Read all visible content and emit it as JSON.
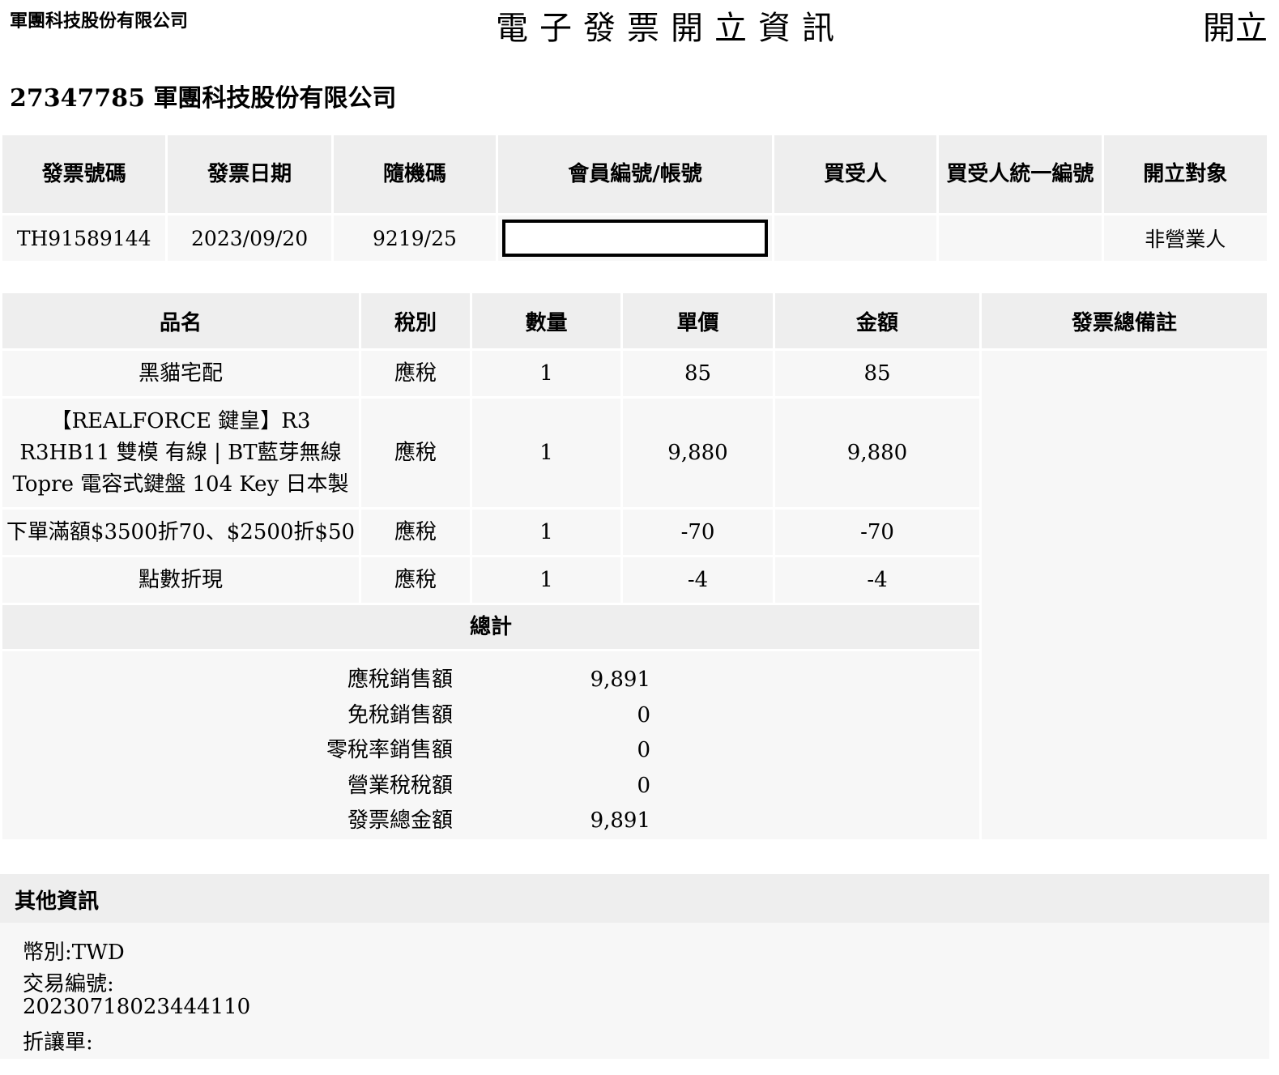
{
  "header": {
    "company": "軍團科技股份有限公司",
    "title": "電子發票開立資訊",
    "status": "開立"
  },
  "seller": "27347785 軍團科技股份有限公司",
  "invoice": {
    "headers": [
      "發票號碼",
      "發票日期",
      "隨機碼",
      "會員編號/帳號",
      "買受人",
      "買受人統一編號",
      "開立對象"
    ],
    "number": "TH91589144",
    "date": "2023/09/20",
    "random_code": "9219/25",
    "member_id": "",
    "buyer": "",
    "buyer_tax_id": "",
    "recipient_type": "非營業人"
  },
  "items": {
    "headers": [
      "品名",
      "稅別",
      "數量",
      "單價",
      "金額",
      "發票總備註"
    ],
    "rows": [
      {
        "name": "黑貓宅配",
        "tax": "應稅",
        "qty": "1",
        "price": "85",
        "amount": "85"
      },
      {
        "name": "【REALFORCE 鍵皇】R3 R3HB11 雙模 有線 | BT藍芽無線 Topre 電容式鍵盤 104 Key 日本製",
        "tax": "應稅",
        "qty": "1",
        "price": "9,880",
        "amount": "9,880"
      },
      {
        "name": "下單滿額$3500折70、$2500折$50",
        "tax": "應稅",
        "qty": "1",
        "price": "-70",
        "amount": "-70"
      },
      {
        "name": "點數折現",
        "tax": "應稅",
        "qty": "1",
        "price": "-4",
        "amount": "-4"
      }
    ],
    "note": ""
  },
  "totals": {
    "title": "總計",
    "lines": [
      {
        "label": "應稅銷售額",
        "value": "9,891"
      },
      {
        "label": "免稅銷售額",
        "value": "0"
      },
      {
        "label": "零稅率銷售額",
        "value": "0"
      },
      {
        "label": "營業稅稅額",
        "value": "0"
      },
      {
        "label": "發票總金額",
        "value": "9,891"
      }
    ]
  },
  "other": {
    "title": "其他資訊",
    "currency": "幣別:TWD",
    "transaction_label": "交易編號:",
    "transaction_id": "20230718023444110",
    "discount_label": "折讓單:"
  }
}
